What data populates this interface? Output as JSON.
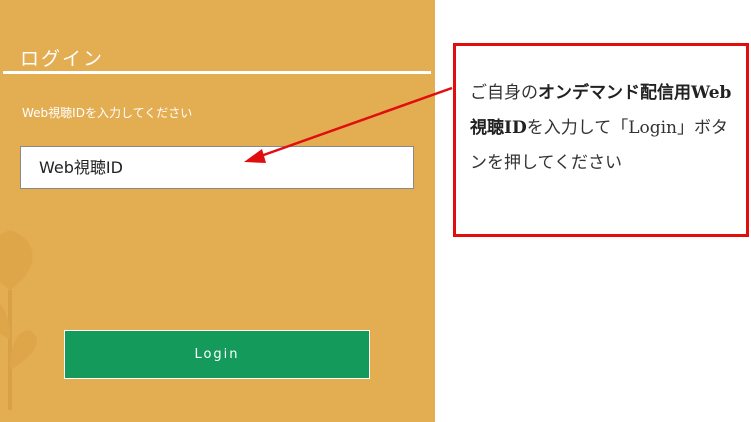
{
  "login_panel": {
    "title": "ログイン",
    "instruction": "Web視聴IDを入力してください",
    "id_input": {
      "value": "",
      "placeholder": "Web視聴ID"
    },
    "login_button_label": "Login"
  },
  "callout": {
    "parts": [
      "ご自身の",
      "オンデマンド配信用Web視聴ID",
      "を入力して「Login」ボタンを押してください"
    ]
  },
  "colors": {
    "panel_background": "#e3ad52",
    "login_button": "#149a5b",
    "callout_border": "#e00e0e",
    "arrow": "#e00e0e"
  }
}
